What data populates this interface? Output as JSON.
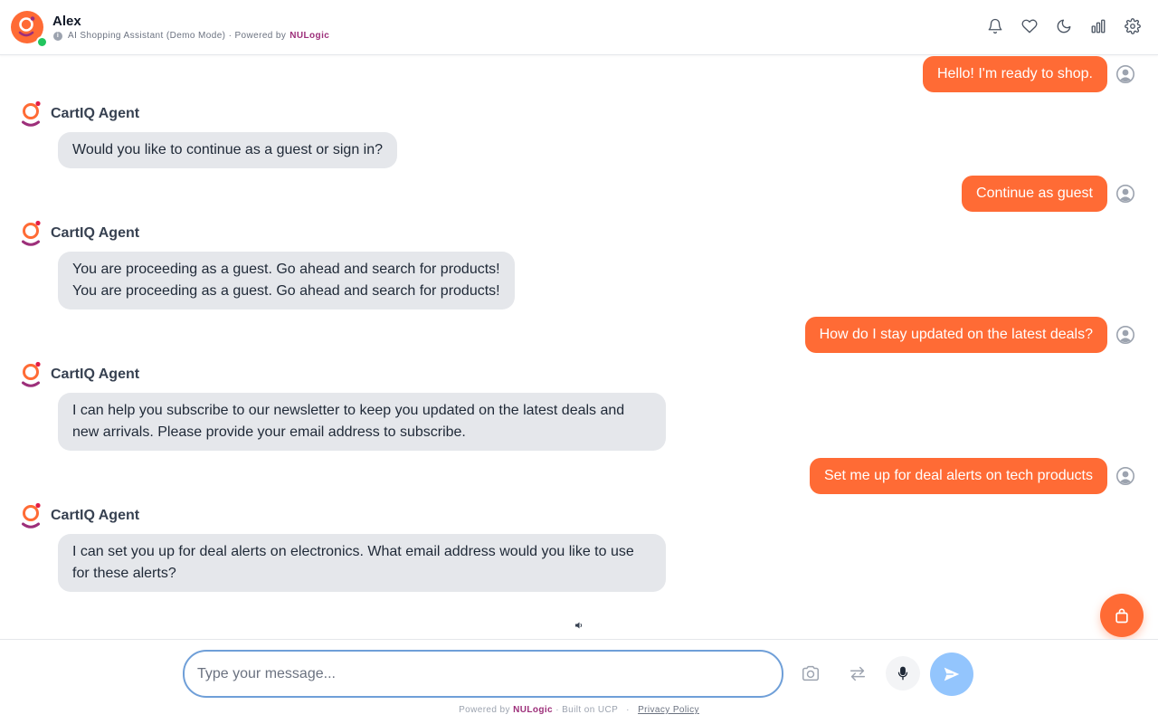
{
  "header": {
    "name": "Alex",
    "subtitle": "AI Shopping Assistant (Demo Mode) · Powered by",
    "brand": "NULogic",
    "status": "online",
    "icons": [
      "bell-icon",
      "heart-icon",
      "moon-icon",
      "bar-chart-icon",
      "gear-icon"
    ]
  },
  "messages": [
    {
      "role": "user",
      "text": "Hello! I'm ready to shop."
    },
    {
      "role": "agent",
      "name": "CartIQ Agent",
      "lines": [
        "Would you like to continue as a guest or sign in?"
      ]
    },
    {
      "role": "user",
      "text": "Continue as guest"
    },
    {
      "role": "agent",
      "name": "CartIQ Agent",
      "lines": [
        "You are proceeding as a guest. Go ahead and search for products!",
        "You are proceeding as a guest. Go ahead and search for products!"
      ]
    },
    {
      "role": "user",
      "text": "How do I stay updated on the latest deals?"
    },
    {
      "role": "agent",
      "name": "CartIQ Agent",
      "lines": [
        "I can help you subscribe to our newsletter to keep you updated on the latest deals and",
        "new arrivals. Please provide your email address to subscribe."
      ]
    },
    {
      "role": "user",
      "text": "Set me up for deal alerts on tech products"
    },
    {
      "role": "agent",
      "name": "CartIQ Agent",
      "lines": [
        "I can set you up for deal alerts on electronics. What email address would you like to use",
        "for these alerts?"
      ]
    }
  ],
  "composer": {
    "placeholder": "Type your message...",
    "value": ""
  },
  "footer": {
    "powered_prefix": "Powered by",
    "brand": "NULogic",
    "built_on": "· Built on UCP",
    "privacy": "Privacy Policy"
  },
  "colors": {
    "accent": "#ff6b35",
    "brand": "#9d2f7a",
    "agent_bubble": "#e5e7eb",
    "send_button": "#93c5fd",
    "input_border": "#6f9fd8"
  }
}
